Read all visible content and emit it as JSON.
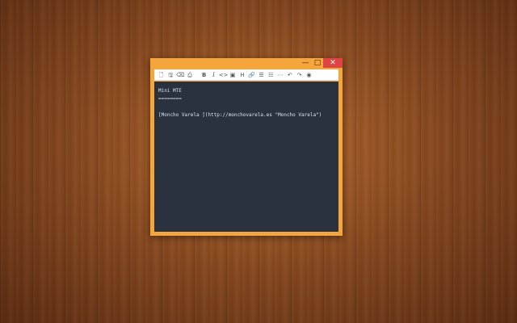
{
  "window": {
    "controls": {
      "minimize": "—",
      "maximize": "□",
      "close": "✕"
    }
  },
  "toolbar": {
    "groups": [
      [
        "new-file",
        "save",
        "eraser",
        "print"
      ],
      [
        "bold",
        "italic",
        "code",
        "image",
        "heading",
        "link",
        "ordered-list",
        "unordered-list",
        "horizontal-rule",
        "undo",
        "redo",
        "preview"
      ]
    ],
    "glyphs": {
      "new-file": "🗋",
      "save": "🖫",
      "eraser": "⌫",
      "print": "⎙",
      "bold": "B",
      "italic": "I",
      "code": "<>",
      "image": "▣",
      "heading": "H",
      "link": "🔗",
      "ordered-list": "☰",
      "unordered-list": "☷",
      "horizontal-rule": "⋯",
      "undo": "↶",
      "redo": "↷",
      "preview": "◉"
    }
  },
  "editor": {
    "lines": [
      "Mini MTE",
      "========",
      "",
      "[Moncho Varela ](http://monchovarela.es \"Moncho Varela\")"
    ]
  },
  "colors": {
    "window_frame": "#f4a63a",
    "editor_bg": "#2a3240",
    "editor_text": "#dfe3ea",
    "close_button": "#e04343"
  }
}
